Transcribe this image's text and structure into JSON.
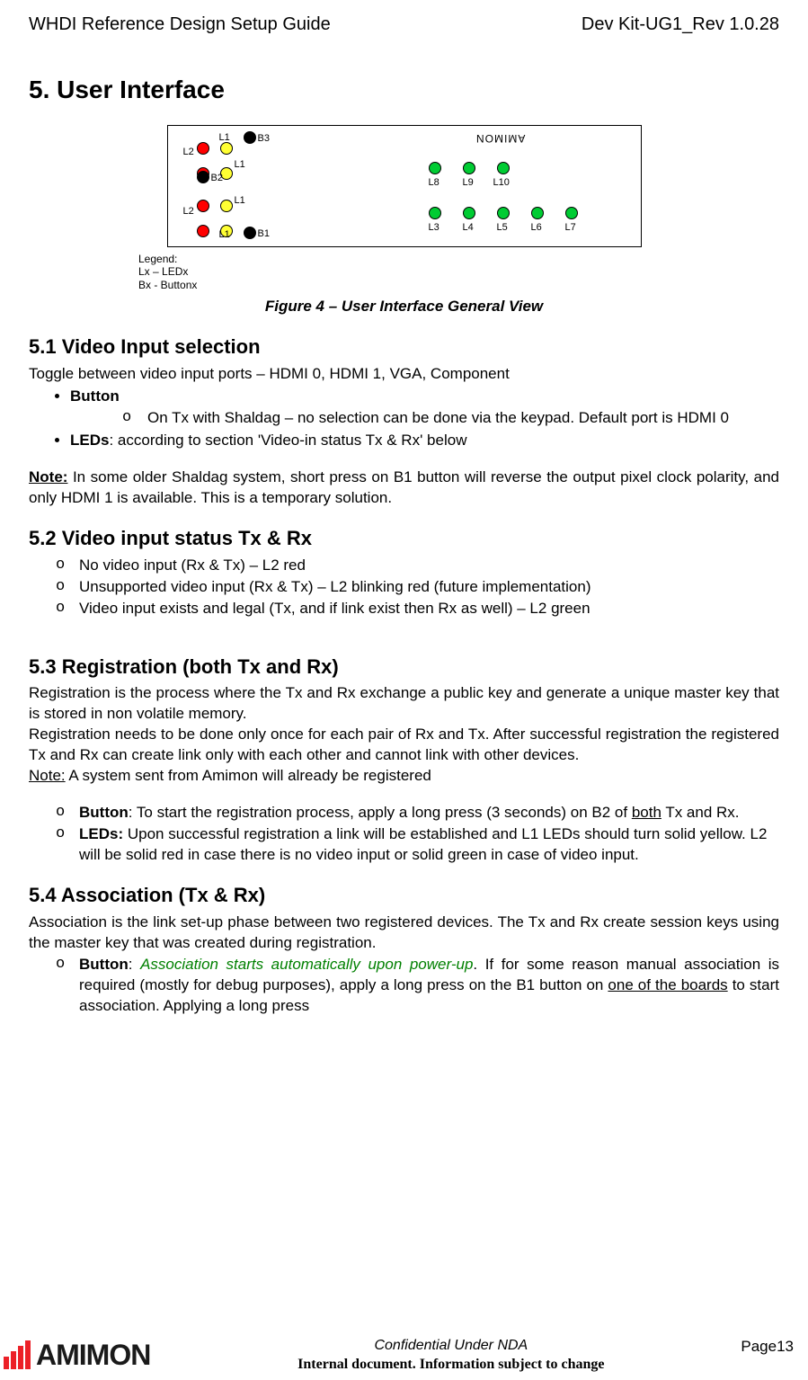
{
  "header": {
    "left": "WHDI Reference Design Setup Guide",
    "right": "Dev Kit-UG1_Rev 1.0.28"
  },
  "title": "5.  User Interface",
  "figure": {
    "caption": "Figure 4 – User Interface General View",
    "legend_title": "Legend:",
    "legend_l1": "Lx – LEDx",
    "legend_l2": "Bx - Buttonx",
    "labels": {
      "L1a": "L1",
      "L1b": "L1",
      "L1c": "L1",
      "L1d": "L1",
      "L2a": "L2",
      "L2b": "L2",
      "B1": "B1",
      "B2": "B2",
      "B3": "B3",
      "L3": "L3",
      "L4": "L4",
      "L5": "L5",
      "L6": "L6",
      "L7": "L7",
      "L8": "L8",
      "L9": "L9",
      "L10": "L10",
      "AMIMON": "AMIMON"
    }
  },
  "s51": {
    "heading": "5.1  Video Input selection",
    "intro": "Toggle between video input ports – HDMI 0, HDMI 1, VGA, Component",
    "b_button": "Button",
    "b_button_sub": "On Tx with Shaldag – no selection can be done via the keypad. Default port is HDMI 0",
    "b_leds_1": "LEDs",
    "b_leds_2": ": according to section 'Video-in status Tx & Rx' below",
    "note_label": "Note:",
    "note_body": " In some older Shaldag system, short press on B1 button will reverse the output pixel clock polarity, and only HDMI 1 is available. This is a temporary solution."
  },
  "s52": {
    "heading": "5.2  Video input status Tx & Rx",
    "i1": "No video input (Rx & Tx) – L2 red",
    "i2": "Unsupported video input (Rx & Tx) – L2 blinking red (future implementation)",
    "i3": "Video input exists and legal (Tx, and if link exist then Rx as well) – L2 green"
  },
  "s53": {
    "heading": "5.3  Registration (both Tx and Rx)",
    "p1": "Registration is the process where the Tx and Rx exchange a public key and generate a unique master key that is stored in non volatile memory.",
    "p2": "Registration needs to be done only once for each pair of Rx and Tx. After successful registration the registered Tx and Rx can create link only with each other and cannot link with other devices.",
    "note_u": "Note:",
    "note_rest": " A system sent from Amimon will already be registered",
    "li1a": "Button",
    "li1b": ": To start the registration process, apply a long press (3 seconds) on B2 of ",
    "li1c": "both",
    "li1d": " Tx and Rx.",
    "li2a": "LEDs:",
    "li2b": " Upon successful registration a link will be established and L1 LEDs should turn solid yellow. L2 will be solid red in case there is no video input or solid green in case of video input."
  },
  "s54": {
    "heading": "5.4  Association (Tx & Rx)",
    "p1": "Association is the link set-up phase between two registered devices. The Tx and Rx create session keys using the master key that was created during registration.",
    "li1a": "Button",
    "li1b": ": ",
    "li1c": "Association starts automatically upon power-up",
    "li1d": ".  If for some reason manual association is required (mostly for debug purposes), apply a long press on the B1 button on ",
    "li1e": "one of the boards",
    "li1f": " to start association.  Applying a long press"
  },
  "footer": {
    "brand": "AMIMON",
    "center1": "Confidential Under NDA",
    "center2": "Internal document. Information subject to change",
    "page": "Page13"
  }
}
